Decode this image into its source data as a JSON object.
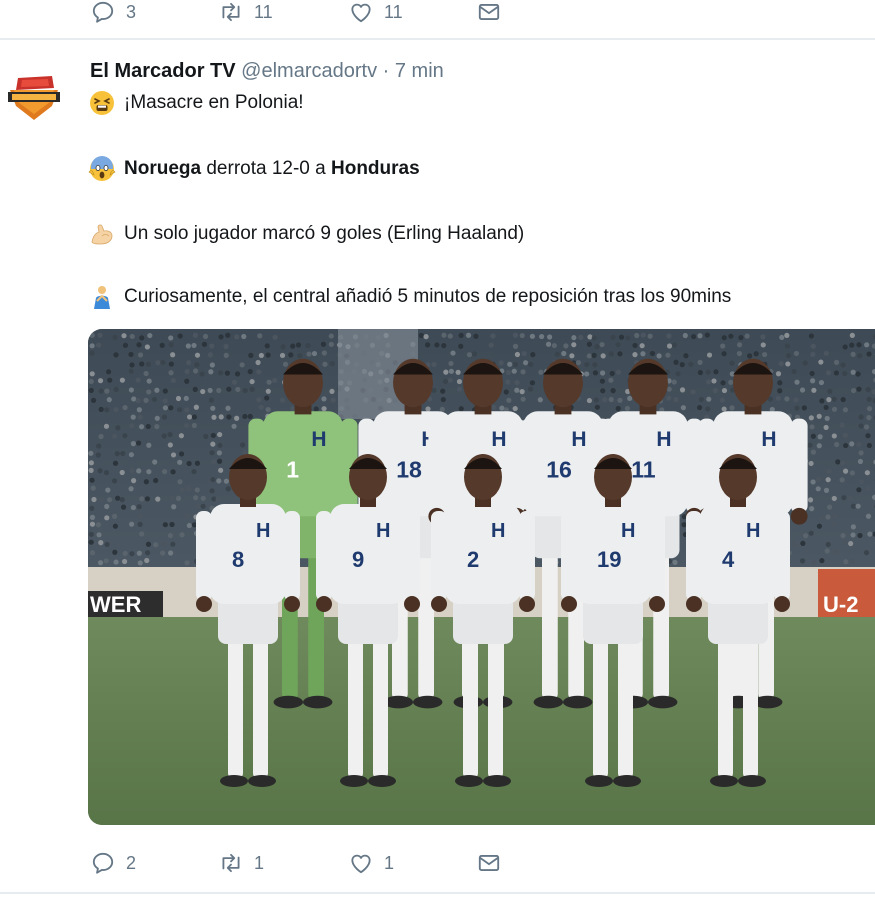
{
  "previous_tweet": {
    "actions": {
      "reply_count": "3",
      "retweet_count": "11",
      "like_count": "11"
    }
  },
  "tweet": {
    "author_name": "El Marcador TV",
    "handle": "@elmarcadortv",
    "separator": "·",
    "time": "7 min",
    "lines": [
      {
        "emoji": "tired-face-icon",
        "text": "¡Masacre en Polonia!"
      },
      {
        "emoji": "screaming-face-icon",
        "bold1": "Noruega",
        "mid": " derrota 12-0 a ",
        "bold2": "Honduras"
      },
      {
        "emoji": "flexed-biceps-icon",
        "text": "Un solo jugador marcó 9 goles (Erling Haaland)"
      },
      {
        "emoji": "keycap-two-icon",
        "text": "Curiosamente, el central añadió 5 minutos de reposición tras los 90mins"
      }
    ],
    "photo": {
      "banner_left": "WER",
      "banner_right": "U-2",
      "players_back": [
        {
          "number": "1",
          "kit": "goalkeeper-green"
        },
        {
          "number": "18",
          "kit": "white"
        },
        {
          "number": "",
          "kit": "white"
        },
        {
          "number": "16",
          "kit": "white"
        },
        {
          "number": "11",
          "kit": "white"
        },
        {
          "number": "",
          "kit": "white"
        }
      ],
      "players_front": [
        {
          "number": "8",
          "kit": "white"
        },
        {
          "number": "9",
          "kit": "white"
        },
        {
          "number": "2",
          "kit": "white"
        },
        {
          "number": "19",
          "kit": "white"
        },
        {
          "number": "4",
          "kit": "white"
        }
      ]
    },
    "actions": {
      "reply_count": "2",
      "retweet_count": "1",
      "like_count": "1"
    }
  },
  "colors": {
    "muted": "#657786",
    "divider": "#e6ecf0",
    "text": "#14171a"
  }
}
